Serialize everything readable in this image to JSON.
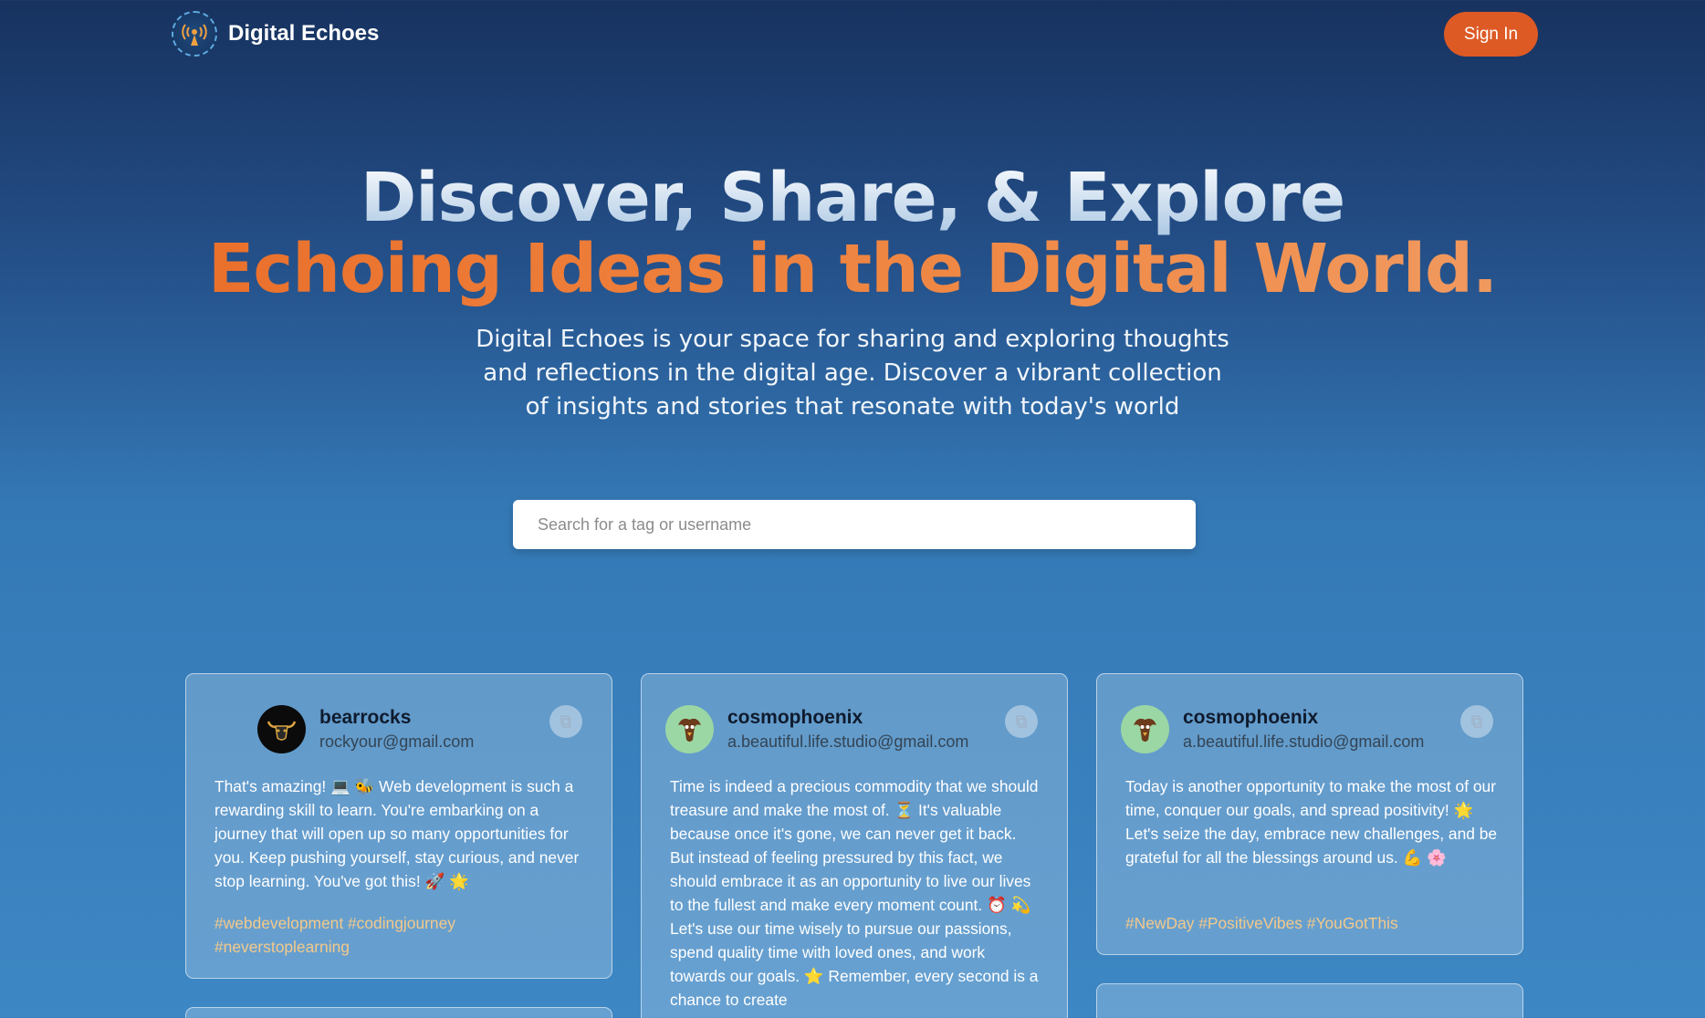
{
  "header": {
    "brand_name": "Digital Echoes",
    "signin_label": "Sign In"
  },
  "hero": {
    "line1": "Discover, Share, & Explore",
    "line2": "Echoing Ideas in the Digital World.",
    "description": "Digital Echoes is your space for sharing and exploring thoughts and reflections in the digital age. Discover a vibrant collection of insights and stories that resonate with today's world"
  },
  "search": {
    "placeholder": "Search for a tag or username"
  },
  "cards": [
    {
      "username": "bearrocks",
      "email": "rockyour@gmail.com",
      "body": "That's amazing! 💻 🐝 Web development is such a rewarding skill to learn. You're embarking on a journey that will open up so many opportunities for you. Keep pushing yourself, stay curious, and never stop learning. You've got this! 🚀 🌟",
      "tags": "#webdevelopment #codingjourney #neverstoplearning"
    },
    {
      "username": "cosmophoenix",
      "email": "a.beautiful.life.studio@gmail.com",
      "body": "Time is indeed a precious commodity that we should treasure and make the most of. ⏳ It's valuable because once it's gone, we can never get it back. But instead of feeling pressured by this fact, we should embrace it as an opportunity to live our lives to the fullest and make every moment count. ⏰ 💫 Let's use our time wisely to pursue our passions, spend quality time with loved ones, and work towards our goals. ⭐ Remember, every second is a chance to create",
      "tags": ""
    },
    {
      "username": "cosmophoenix",
      "email": "a.beautiful.life.studio@gmail.com",
      "body": "Today is another opportunity to make the most of our time, conquer our goals, and spread positivity! 🌟 Let's seize the day, embrace new challenges, and be grateful for all the blessings around us. 💪 🌸",
      "tags": "#NewDay #PositiveVibes #YouGotThis"
    }
  ],
  "colors": {
    "accent": "#dd5a25",
    "tag": "#f4c98a",
    "background_top": "#17325f",
    "background_bottom": "#3d87c4"
  },
  "icons": {
    "logo": "broadcast-icon",
    "copy": "copy-icon"
  }
}
